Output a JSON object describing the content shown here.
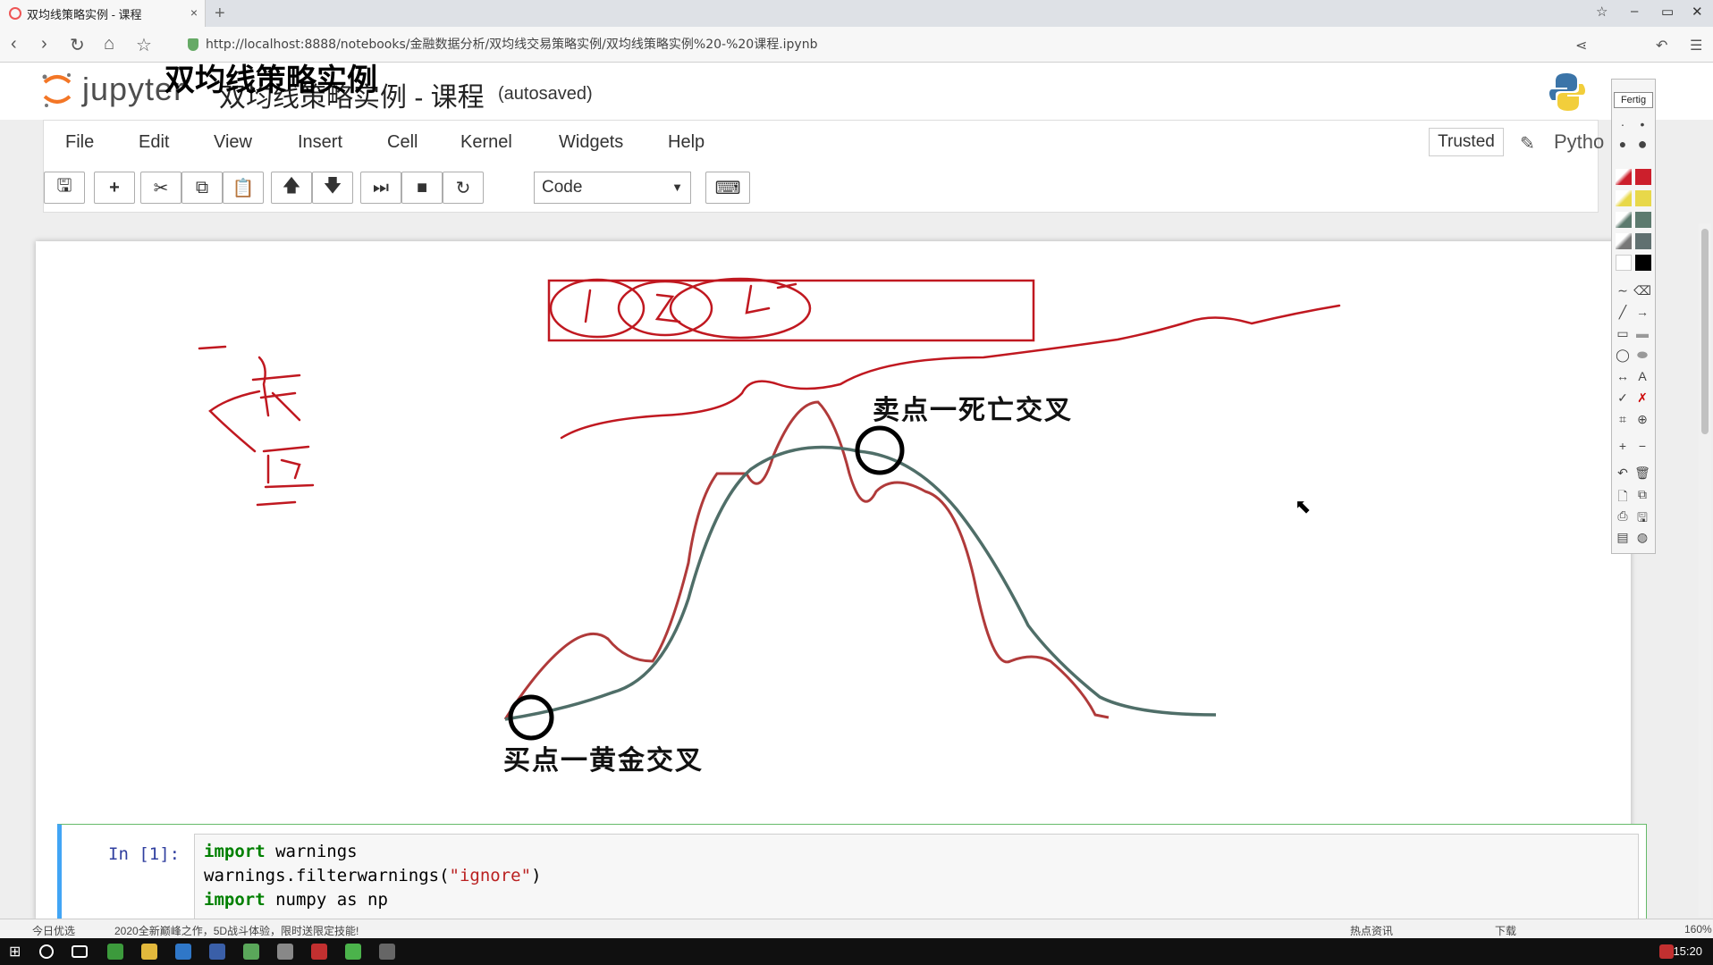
{
  "browser": {
    "tab_title": "双均线策略实例 - 课程",
    "tab_close": "×",
    "new_tab": "+",
    "url": "http://localhost:8888/notebooks/金融数据分析/双均线交易策略实例/双均线策略实例%20-%20课程.ipynb"
  },
  "header": {
    "logo_text": "jupyter",
    "notebook_title": "双均线策略实例 - 课程",
    "autosave_status": "(autosaved)"
  },
  "menu": {
    "items": [
      "File",
      "Edit",
      "View",
      "Insert",
      "Cell",
      "Kernel",
      "Widgets",
      "Help"
    ],
    "trusted_label": "Trusted",
    "kernel_name": "Pytho"
  },
  "toolbar": {
    "cell_type": "Code",
    "buttons": [
      "save-icon",
      "plus-icon",
      "scissors-icon",
      "copy-icon",
      "paste-icon",
      "arrow-up-icon",
      "arrow-down-icon",
      "run-icon",
      "stop-icon",
      "restart-icon",
      "keyboard-icon"
    ]
  },
  "markdown": {
    "title": "双均线策略实例"
  },
  "figure": {
    "sell_label": "卖点一死亡交叉",
    "buy_label": "买点一黄金交叉",
    "price_color": "#b03a3a",
    "ma_color": "#4f6e68"
  },
  "code_cell": {
    "prompt": "In  [1]:",
    "lines": [
      {
        "kw": "import",
        "rest": " warnings"
      },
      {
        "pre": "warnings.filterwarnings(",
        "str": "\"ignore\"",
        "post": ")"
      },
      {
        "kw": "import",
        "rest": " numpy as np"
      }
    ]
  },
  "palette": {
    "done_label": "Fertig",
    "colors": [
      "#cc1f2c",
      "#e8d84a",
      "#5c7a6e",
      "#000000",
      "#ffffff"
    ]
  },
  "statusbar": {
    "left": "今日优选",
    "ad": "2020全新巅峰之作，5D战斗体验，限时送限定技能!",
    "news": "热点资讯",
    "download": "下载",
    "zoom": "160%"
  },
  "taskbar": {
    "clock": "15:20"
  }
}
